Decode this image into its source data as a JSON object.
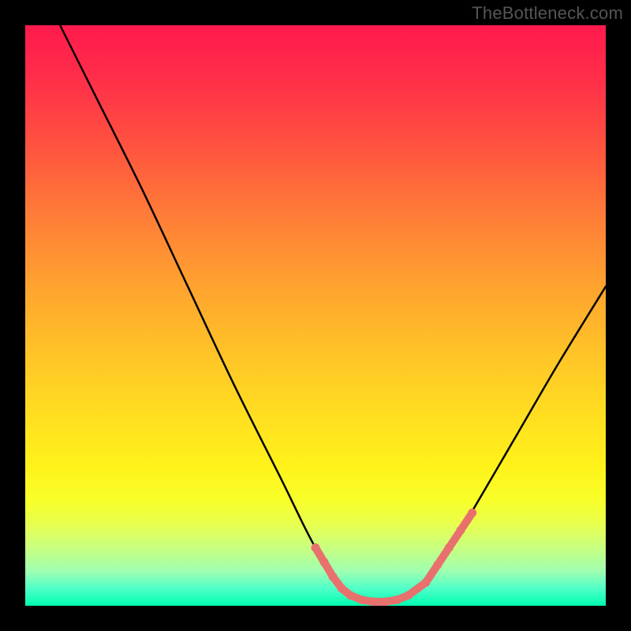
{
  "watermark": "TheBottleneck.com",
  "chart_data": {
    "type": "line",
    "title": "",
    "xlabel": "",
    "ylabel": "",
    "xlim": [
      0,
      100
    ],
    "ylim": [
      0,
      100
    ],
    "background_gradient": {
      "orientation": "vertical",
      "stops": [
        {
          "pos": 0.0,
          "color": "#ff1a4d"
        },
        {
          "pos": 0.5,
          "color": "#ffb028"
        },
        {
          "pos": 0.8,
          "color": "#fff21a"
        },
        {
          "pos": 1.0,
          "color": "#00ffb0"
        }
      ]
    },
    "series": [
      {
        "name": "curve",
        "color": "#000000",
        "points": [
          {
            "x": 6,
            "y": 100
          },
          {
            "x": 12,
            "y": 88
          },
          {
            "x": 20,
            "y": 72
          },
          {
            "x": 28,
            "y": 55
          },
          {
            "x": 36,
            "y": 38
          },
          {
            "x": 44,
            "y": 22
          },
          {
            "x": 50,
            "y": 10
          },
          {
            "x": 55,
            "y": 3
          },
          {
            "x": 59,
            "y": 0.5
          },
          {
            "x": 63,
            "y": 0.5
          },
          {
            "x": 67,
            "y": 2
          },
          {
            "x": 72,
            "y": 8
          },
          {
            "x": 78,
            "y": 18
          },
          {
            "x": 85,
            "y": 30
          },
          {
            "x": 92,
            "y": 42
          },
          {
            "x": 100,
            "y": 55
          }
        ]
      },
      {
        "name": "highlighted-points",
        "color": "#e8716e",
        "style": "dashed-markers",
        "points": [
          {
            "x": 50,
            "y": 10
          },
          {
            "x": 51.5,
            "y": 7.5
          },
          {
            "x": 53,
            "y": 5
          },
          {
            "x": 54.5,
            "y": 3
          },
          {
            "x": 56,
            "y": 1.8
          },
          {
            "x": 58,
            "y": 1.0
          },
          {
            "x": 60,
            "y": 0.7
          },
          {
            "x": 62,
            "y": 0.7
          },
          {
            "x": 64,
            "y": 1.0
          },
          {
            "x": 66,
            "y": 1.8
          },
          {
            "x": 69,
            "y": 4
          },
          {
            "x": 71,
            "y": 7
          },
          {
            "x": 73,
            "y": 10
          },
          {
            "x": 75,
            "y": 13
          },
          {
            "x": 77,
            "y": 16
          }
        ]
      }
    ]
  }
}
